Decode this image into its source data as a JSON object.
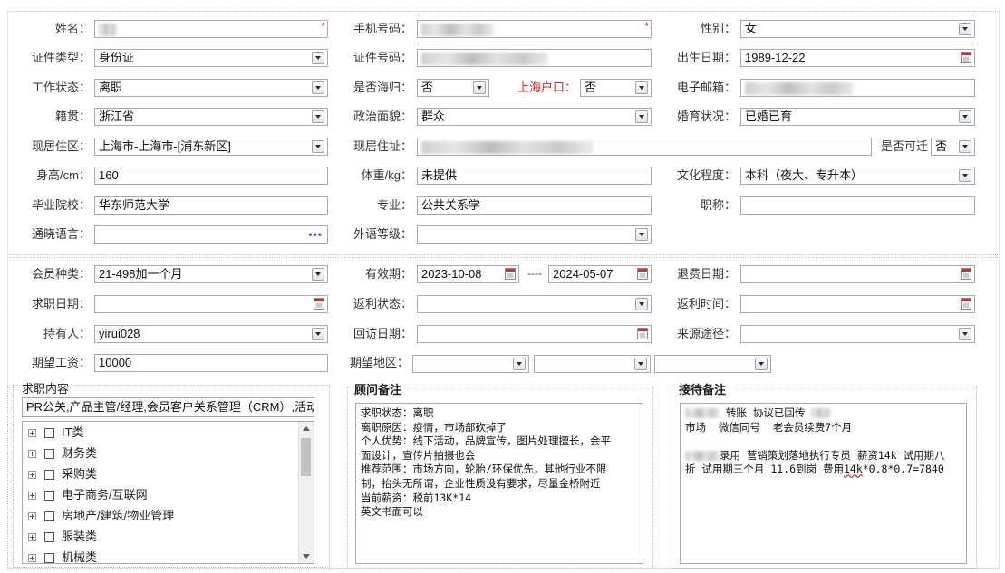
{
  "basic": {
    "name": {
      "label": "姓名："
    },
    "phone": {
      "label": "手机号码："
    },
    "gender": {
      "label": "性别：",
      "value": "女"
    },
    "id_type": {
      "label": "证件类型：",
      "value": "身份证"
    },
    "id_number": {
      "label": "证件号码："
    },
    "birth_date": {
      "label": "出生日期：",
      "value": "1989-12-22"
    },
    "work_status": {
      "label": "工作状态：",
      "value": "离职"
    },
    "overseas_return": {
      "label": "是否海归：",
      "value": "否"
    },
    "shanghai_hukou": {
      "label": "上海户口：",
      "value": "否"
    },
    "email": {
      "label": "电子邮箱："
    },
    "native_place": {
      "label": "籍贯：",
      "value": "浙江省"
    },
    "political_status": {
      "label": "政治面貌：",
      "value": "群众"
    },
    "marital_status": {
      "label": "婚育状况：",
      "value": "已婚已育"
    },
    "residence_area": {
      "label": "现居住区：",
      "value": "上海市-上海市-[浦东新区]"
    },
    "residence_address": {
      "label": "现居住址："
    },
    "relocatable": {
      "label": "是否可迁",
      "value": "否"
    },
    "height": {
      "label": "身高/cm：",
      "value": "160"
    },
    "weight": {
      "label": "体重/kg：",
      "value": "未提供"
    },
    "education": {
      "label": "文化程度：",
      "value": "本科（夜大、专升本）"
    },
    "school": {
      "label": "毕业院校：",
      "value": "华东师范大学"
    },
    "major": {
      "label": "专业：",
      "value": "公共关系学"
    },
    "title": {
      "label": "职称："
    },
    "languages": {
      "label": "通晓语言：",
      "value": ""
    },
    "foreign_level": {
      "label": "外语等级：",
      "value": ""
    }
  },
  "membership": {
    "member_type": {
      "label": "会员种类：",
      "value": "21-498加一个月"
    },
    "validity": {
      "label": "有效期：",
      "from": "2023-10-08",
      "separator": "----",
      "to": "2024-05-07"
    },
    "refund_date": {
      "label": "退费日期：",
      "value": ""
    },
    "job_date": {
      "label": "求职日期：",
      "value": ""
    },
    "rebate_status": {
      "label": "返利状态：",
      "value": ""
    },
    "rebate_time": {
      "label": "返利时间：",
      "value": ""
    },
    "holder": {
      "label": "持有人：",
      "value": "yirui028"
    },
    "revisit_date": {
      "label": "回访日期：",
      "value": ""
    },
    "source": {
      "label": "来源途径：",
      "value": ""
    },
    "expected_salary": {
      "label": "期望工资：",
      "value": "10000"
    },
    "expected_area": {
      "label": "期望地区：",
      "value": ""
    }
  },
  "job_content": {
    "title": "求职内容",
    "summary": "PR公关,产品主管/经理,会员客户关系管理（CRM）,活动策划",
    "categories": [
      "IT类",
      "财务类",
      "采购类",
      "电子商务/互联网",
      "房地产/建筑/物业管理",
      "服装类",
      "机械类"
    ]
  },
  "consultant_notes": {
    "title": "顾问备注",
    "lines": [
      "求职状态：离职",
      "离职原因：疫情，市场部砍掉了",
      "个人优势：线下活动，品牌宣传，图片处理擅长，会平",
      "面设计，宣传片拍摄也会",
      "推荐范围：市场方向，轮胎/环保优先，其他行业不限",
      "制，抬头无所谓，企业性质没有要求，尽量金桥附近",
      "当前薪资：税前13K*14",
      "英文书面可以"
    ]
  },
  "reception_notes": {
    "title": "接待备注",
    "line1_text": " 转账 协议已回传",
    "line2": "市场  微信同号  老会员续费7个月",
    "line3_text": "录用 营销策划落地执行专员 薪资14k 试用期八",
    "line4_pre": "折 试用期三个月 11.6到岗 费用",
    "line4_mark": "14k",
    "line4_post": "*0.8*0.7=7840"
  }
}
